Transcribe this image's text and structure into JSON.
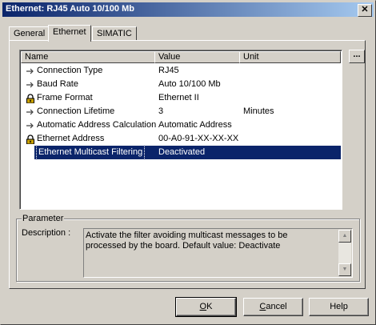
{
  "window": {
    "title": "Ethernet: RJ45 Auto 10/100 Mb",
    "close_glyph": "✕"
  },
  "tabs": [
    {
      "label": "General"
    },
    {
      "label": "Ethernet"
    },
    {
      "label": "SIMATIC"
    }
  ],
  "table": {
    "headers": {
      "name": "Name",
      "value": "Value",
      "unit": "Unit"
    },
    "more_button": "...",
    "rows": [
      {
        "icon": "arrow-pointer-icon",
        "name": "Connection Type",
        "value": "RJ45",
        "unit": ""
      },
      {
        "icon": "arrow-pointer-icon",
        "name": "Baud Rate",
        "value": "Auto 10/100 Mb",
        "unit": ""
      },
      {
        "icon": "padlock-icon",
        "name": "Frame Format",
        "value": "Ethernet II",
        "unit": ""
      },
      {
        "icon": "arrow-pointer-icon",
        "name": "Connection Lifetime",
        "value": "3",
        "unit": "Minutes"
      },
      {
        "icon": "arrow-pointer-icon",
        "name": "Automatic Address Calculation",
        "value": "Automatic Address",
        "unit": ""
      },
      {
        "icon": "padlock-icon",
        "name": "Ethernet Address",
        "value": "00-A0-91-XX-XX-XX",
        "unit": ""
      },
      {
        "icon": "arrow-pointer-icon",
        "name": "Ethernet Multicast Filtering",
        "value": "Deactivated",
        "unit": "",
        "selected": true
      }
    ]
  },
  "parameter": {
    "group_label": "Parameter",
    "description_label": "Description :",
    "description_text": "Activate the filter avoiding multicast messages to be processed by the board. Default value: Deactivate"
  },
  "buttons": {
    "ok": {
      "pre": "",
      "ul": "O",
      "post": "K"
    },
    "cancel": {
      "pre": "",
      "ul": "C",
      "post": "ancel"
    },
    "help": "Help"
  },
  "colors": {
    "selection": "#0a246a",
    "face": "#d4d0c8"
  }
}
